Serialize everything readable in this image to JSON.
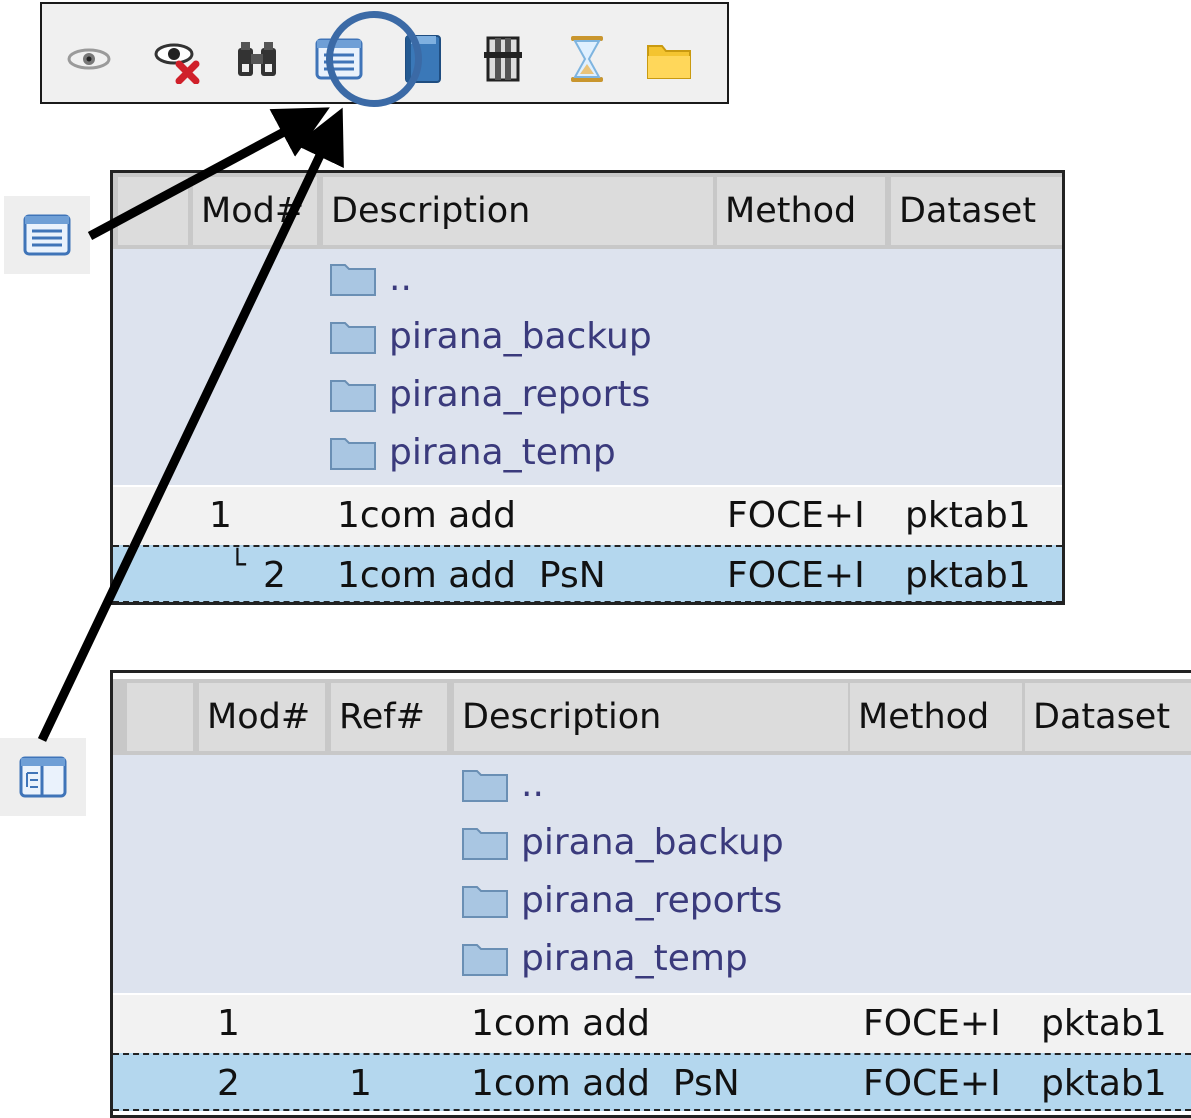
{
  "toolbar": {
    "icons": [
      "eye-icon",
      "hide-eye-icon",
      "binoculars-icon",
      "list-view-icon",
      "book-icon",
      "columns-icon",
      "hourglass-icon",
      "folder-icon"
    ],
    "highlighted": "list-view-icon"
  },
  "side_icons": [
    "list-view-icon",
    "tree-view-icon"
  ],
  "table_top": {
    "columns": [
      "Mod#",
      "Description",
      "Method",
      "Dataset"
    ],
    "folders": [
      "..",
      "pirana_backup",
      "pirana_reports",
      "pirana_temp"
    ],
    "rows": [
      {
        "mod": "1",
        "description": "1com add",
        "method": "FOCE+I",
        "dataset": "pktab1"
      },
      {
        "branch": "└",
        "mod": "2",
        "description": "1com add  PsN",
        "method": "FOCE+I",
        "dataset": "pktab1"
      }
    ]
  },
  "table_bottom": {
    "columns": [
      "Mod#",
      "Ref#",
      "Description",
      "Method",
      "Dataset"
    ],
    "folders": [
      "..",
      "pirana_backup",
      "pirana_reports",
      "pirana_temp"
    ],
    "rows": [
      {
        "mod": "1",
        "ref": "",
        "description": "1com add",
        "method": "FOCE+I",
        "dataset": "pktab1"
      },
      {
        "mod": "2",
        "ref": "1",
        "description": "1com add  PsN",
        "method": "FOCE+I",
        "dataset": "pktab1"
      }
    ]
  },
  "colors": {
    "highlight_ring": "#3b6aa6",
    "folder_area": "#dde3ee",
    "selected_row": "#b4d7ee",
    "folder_text": "#3a3a7c"
  }
}
